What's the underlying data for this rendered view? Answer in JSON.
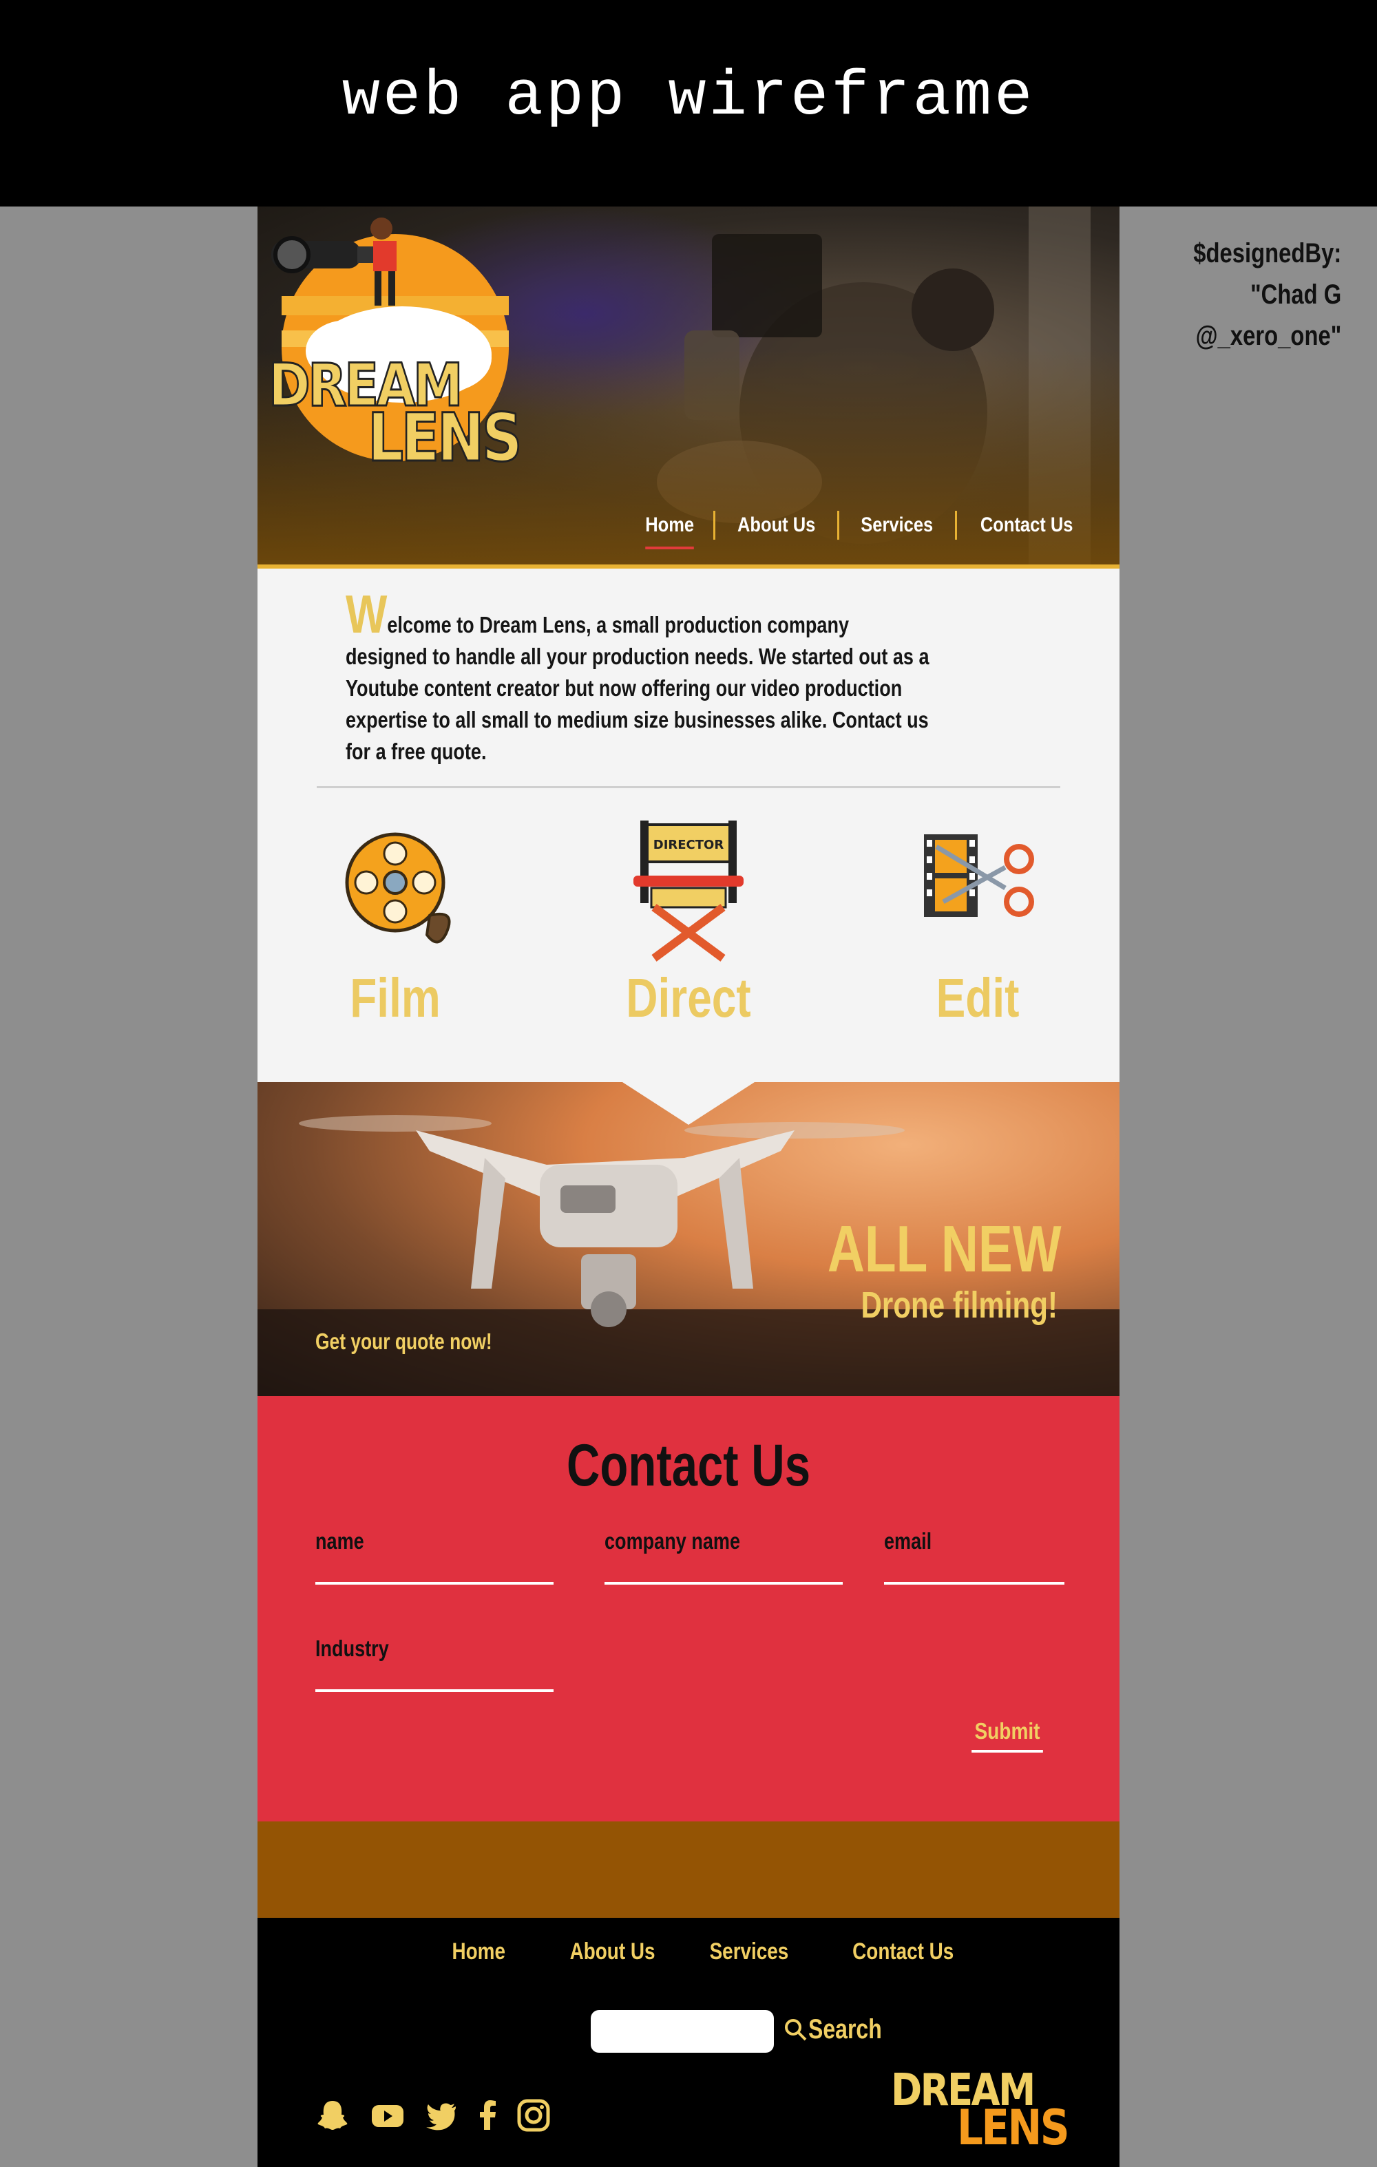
{
  "banner": {
    "title": "web app wireframe"
  },
  "credit": {
    "line1": "$designedBy:",
    "line2": "\"Chad G",
    "line3": "@_xero_one\""
  },
  "logo": {
    "line1": "DREAM",
    "line2": "LENS"
  },
  "nav": {
    "home": "Home",
    "about": "About Us",
    "services": "Services",
    "contact": "Contact Us"
  },
  "welcome": {
    "dropcap": "W",
    "text": "elcome to Dream Lens, a small production company designed to handle all your production needs. We started out as a Youtube content creator but now offering our video production expertise to all small to medium size businesses alike. Contact us for a free quote."
  },
  "services": {
    "film": "Film",
    "direct": "Direct",
    "edit": "Edit",
    "chair_text": "DIRECTOR"
  },
  "drone": {
    "headline": "ALL NEW",
    "sub": "Drone filming!",
    "cta": "Get your quote now!"
  },
  "contact": {
    "title": "Contact Us",
    "name": "name",
    "company": "company name",
    "email": "email",
    "industry": "Industry",
    "submit": "Submit"
  },
  "footer": {
    "nav": {
      "home": "Home",
      "about": "About Us",
      "services": "Services",
      "contact": "Contact Us"
    },
    "search": "Search",
    "social": [
      "snapchat-icon",
      "youtube-icon",
      "twitter-icon",
      "facebook-icon",
      "instagram-icon"
    ]
  },
  "colors": {
    "gold": "#f1cf63",
    "red": "#e0313f",
    "brown": "#945404",
    "accent": "#e8b233"
  }
}
